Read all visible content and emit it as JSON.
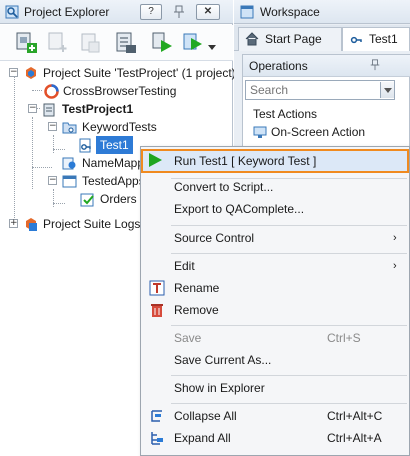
{
  "project_explorer": {
    "title": "Project Explorer",
    "help_label": "?",
    "pin_label": "✕",
    "tree": {
      "suite": "Project Suite 'TestProject' (1 project)",
      "cross_browser": "CrossBrowserTesting",
      "project": "TestProject1",
      "keyword_tests": "KeywordTests",
      "test1": "Test1",
      "name_mapping": "NameMappin",
      "tested_apps": "TestedApps",
      "orders": "Orders",
      "suite_logs": "Project Suite Logs"
    }
  },
  "workspace": {
    "title": "Workspace",
    "tabs": [
      {
        "label": "Start Page"
      },
      {
        "label": "Test1"
      }
    ],
    "operations": {
      "title": "Operations",
      "search_placeholder": "Search",
      "items": [
        {
          "label": "Test Actions"
        },
        {
          "label": "On-Screen Action"
        }
      ]
    }
  },
  "context_menu": {
    "run": {
      "label": "Run Test1  [ Keyword Test ]"
    },
    "convert": {
      "label": "Convert to Script..."
    },
    "export": {
      "label": "Export to QAComplete..."
    },
    "source_control": {
      "label": "Source Control",
      "arrow": "›"
    },
    "edit": {
      "label": "Edit",
      "arrow": "›"
    },
    "rename": {
      "label": "Rename"
    },
    "remove": {
      "label": "Remove"
    },
    "save": {
      "label": "Save",
      "shortcut": "Ctrl+S"
    },
    "save_as": {
      "label": "Save Current As..."
    },
    "show_in_explorer": {
      "label": "Show in Explorer"
    },
    "collapse_all": {
      "label": "Collapse All",
      "shortcut": "Ctrl+Alt+C"
    },
    "expand_all": {
      "label": "Expand All",
      "shortcut": "Ctrl+Alt+A"
    }
  },
  "colors": {
    "selection": "#2e7bd6",
    "menu_highlight_border": "#f08a1f",
    "run_green": "#1fa51f"
  }
}
